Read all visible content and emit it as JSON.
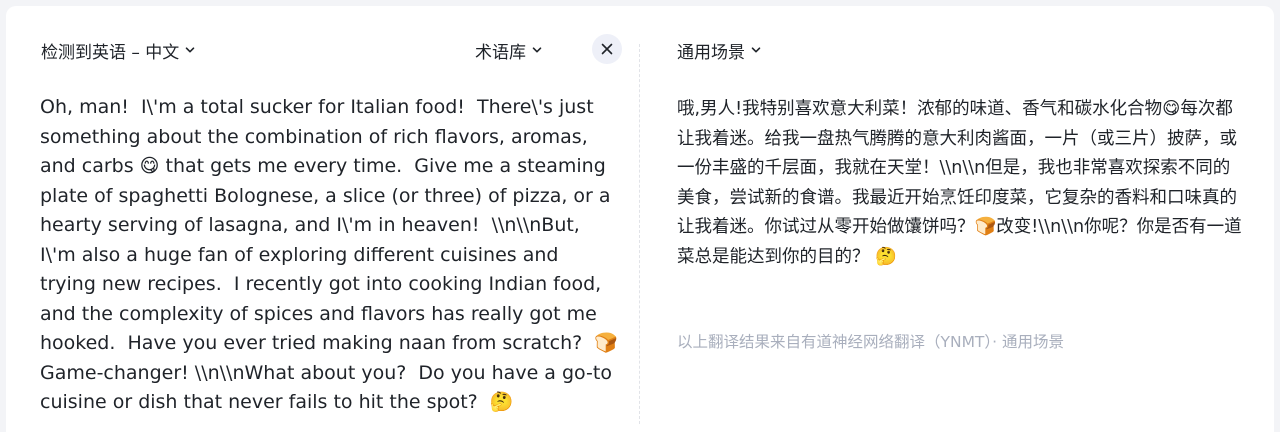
{
  "source_panel": {
    "language_label": "检测到英语 – 中文",
    "glossary_label": "术语库",
    "text": "Oh, man!  I\\'m a total sucker for Italian food!  There\\'s just something about the combination of rich flavors, aromas, and carbs 😋 that gets me every time.  Give me a steaming plate of spaghetti Bolognese, a slice (or three) of pizza, or a hearty serving of lasagna, and I\\'m in heaven!  \\\\n\\\\nBut, I\\'m also a huge fan of exploring different cuisines and trying new recipes.  I recently got into cooking Indian food, and the complexity of spices and flavors has really got me hooked.  Have you ever tried making naan from scratch?  🍞 Game-changer! \\\\n\\\\nWhat about you?  Do you have a go-to cuisine or dish that never fails to hit the spot?  🤔"
  },
  "result_panel": {
    "scenario_label": "通用场景",
    "text": "哦,男人!我特别喜欢意大利菜！浓郁的味道、香气和碳水化合物😋每次都让我着迷。给我一盘热气腾腾的意大利肉酱面，一片（或三片）披萨，或一份丰盛的千层面，我就在天堂！\\\\n\\\\n但是，我也非常喜欢探索不同的美食，尝试新的食谱。我最近开始烹饪印度菜，它复杂的香料和口味真的让我着迷。你试过从零开始做馕饼吗？🍞改变!\\\\n\\\\n你呢？你是否有一道菜总是能达到你的目的？ 🤔",
    "credit": "以上翻译结果来自有道神经网络翻译（YNMT）· 通用场景"
  },
  "icons": {
    "dropdown": "chevron-down-icon",
    "clear": "close-icon"
  },
  "colors": {
    "page_background": "#f3f4f7",
    "card_background": "#ffffff",
    "text_primary": "#1f2329",
    "text_muted": "#a9afbd",
    "close_button_bg": "#eef0f8"
  }
}
